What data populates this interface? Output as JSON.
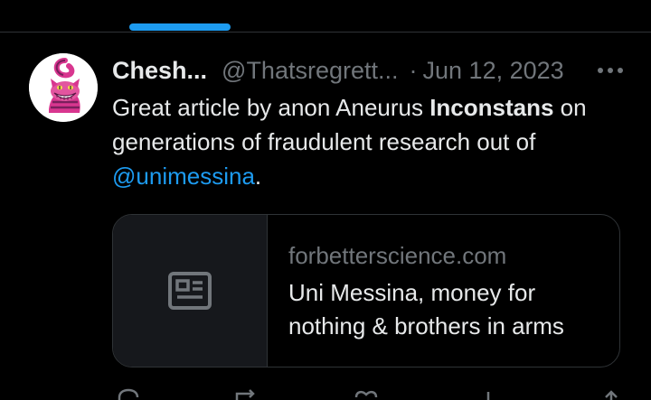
{
  "tweet": {
    "display_name": "Chesh...",
    "handle": "@Thatsregrett...",
    "separator": "·",
    "date": "Jun 12, 2023",
    "more_icon": "more-horizontal-icon",
    "avatar": "cheshire-cat-avatar",
    "text": {
      "part1": "Great article by anon Aneurus ",
      "bold": "Inconstans",
      "part2": " on generations of fraudulent research out of ",
      "mention": "@unimessina",
      "part3": "."
    },
    "card": {
      "icon": "article-icon",
      "domain": "forbetterscience.com",
      "title": "Uni Messina, money for nothing & brothers in arms"
    },
    "actions": [
      {
        "icon": "reply-icon"
      },
      {
        "icon": "repost-icon"
      },
      {
        "icon": "like-icon"
      },
      {
        "icon": "views-icon"
      },
      {
        "icon": "share-icon"
      }
    ]
  },
  "colors": {
    "background": "#000000",
    "text": "#e7e9ea",
    "secondary": "#71767b",
    "accent": "#1d9bf0",
    "border": "#2f3336"
  }
}
